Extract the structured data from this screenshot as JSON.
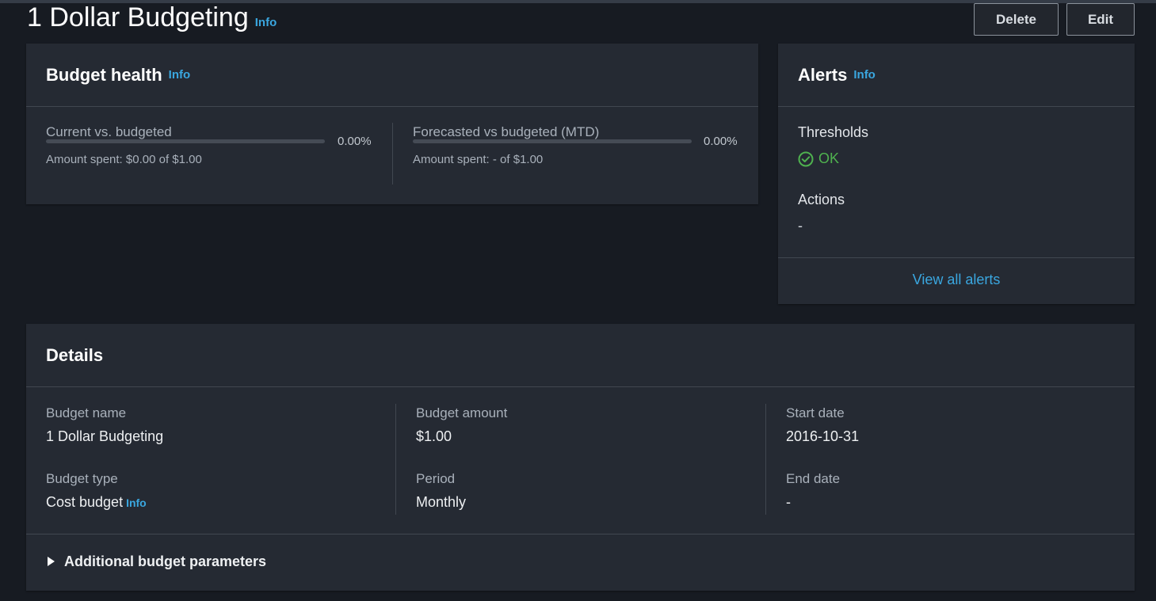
{
  "page": {
    "title": "1 Dollar Budgeting",
    "info_label": "Info",
    "actions": {
      "delete_label": "Delete",
      "edit_label": "Edit"
    }
  },
  "budget_health": {
    "title": "Budget health",
    "info_label": "Info",
    "current": {
      "label": "Current vs. budgeted",
      "percent_text": "0.00%",
      "percent_value": 0,
      "amount_text": "Amount spent: $0.00 of $1.00"
    },
    "forecasted": {
      "label": "Forecasted vs budgeted (MTD)",
      "percent_text": "0.00%",
      "percent_value": 0,
      "amount_text": "Amount spent: - of $1.00"
    }
  },
  "alerts": {
    "title": "Alerts",
    "info_label": "Info",
    "thresholds_label": "Thresholds",
    "thresholds_status": "OK",
    "actions_label": "Actions",
    "actions_value": "-",
    "view_all_label": "View all alerts"
  },
  "details": {
    "title": "Details",
    "budget_name_label": "Budget name",
    "budget_name_value": "1 Dollar Budgeting",
    "budget_type_label": "Budget type",
    "budget_type_value": "Cost budget",
    "budget_type_info": "Info",
    "budget_amount_label": "Budget amount",
    "budget_amount_value": "$1.00",
    "period_label": "Period",
    "period_value": "Monthly",
    "start_date_label": "Start date",
    "start_date_value": "2016-10-31",
    "end_date_label": "End date",
    "end_date_value": "-",
    "additional_label": "Additional budget parameters"
  },
  "colors": {
    "background": "#171b22",
    "panel": "#252a33",
    "accent_link": "#3aa7e0",
    "ok_green": "#4fb24f"
  },
  "icons": {
    "ok": "check-circle-icon",
    "expand": "caret-right-icon"
  }
}
